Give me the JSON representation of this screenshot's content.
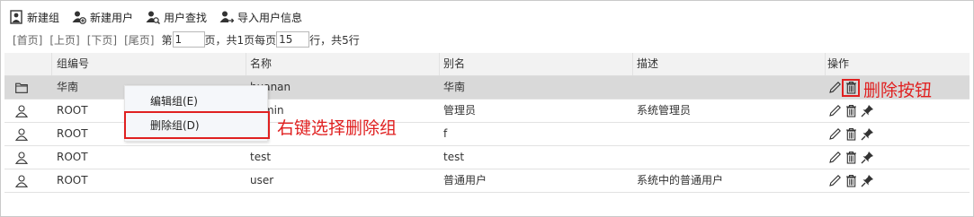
{
  "toolbar": {
    "new_group": "新建组",
    "new_user": "新建用户",
    "user_search": "用户查找",
    "import_users": "导入用户信息"
  },
  "pager": {
    "first": "[首页]",
    "prev": "[上页]",
    "next": "[下页]",
    "last": "[尾页]",
    "page_prefix": "第",
    "page_value": "1",
    "page_suffix": "页，共1页每页",
    "size_value": "15",
    "size_suffix": "行，共5行"
  },
  "table": {
    "headers": {
      "group_id": "组编号",
      "name": "名称",
      "alias": "别名",
      "description": "描述",
      "operations": "操作"
    },
    "rows": [
      {
        "type": "group",
        "group_id": "华南",
        "name": "huanan",
        "alias": "华南",
        "description": ""
      },
      {
        "type": "user",
        "group_id": "ROOT",
        "name": "admin",
        "alias": "管理员",
        "description": "系统管理员"
      },
      {
        "type": "user",
        "group_id": "ROOT",
        "name": "f",
        "alias": "f",
        "description": ""
      },
      {
        "type": "user",
        "group_id": "ROOT",
        "name": "test",
        "alias": "test",
        "description": ""
      },
      {
        "type": "user",
        "group_id": "ROOT",
        "name": "user",
        "alias": "普通用户",
        "description": "系统中的普通用户"
      }
    ]
  },
  "context_menu": {
    "edit_group": "编辑组(E)",
    "delete_group": "删除组(D)"
  },
  "annotations": {
    "delete_button": "删除按钮",
    "right_click_delete": "右键选择删除组",
    "color": "#e02020"
  },
  "icons": {
    "new_group": "user-square-icon",
    "new_user": "user-plus-icon",
    "user_search": "user-search-icon",
    "import_users": "user-import-icon",
    "group_row": "folder-icon",
    "user_row": "person-icon",
    "edit": "pencil-icon",
    "delete": "trash-icon",
    "permission": "pin-icon"
  }
}
